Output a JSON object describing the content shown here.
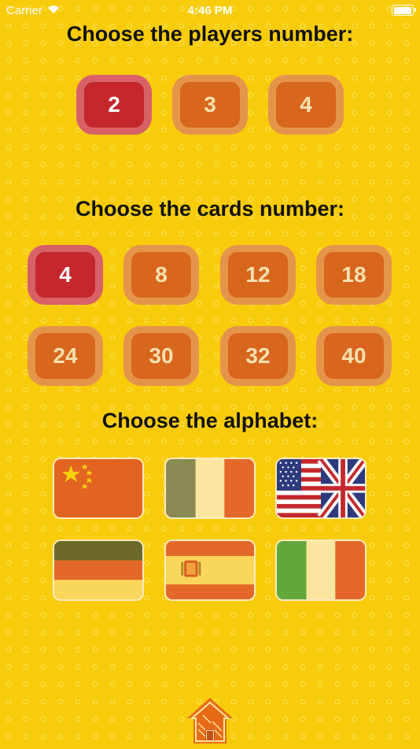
{
  "status": {
    "carrier": "Carrier",
    "time": "4:46 PM"
  },
  "players": {
    "heading": "Choose the players number:",
    "options": [
      "2",
      "3",
      "4"
    ],
    "selected": "2"
  },
  "cards": {
    "heading": "Choose the cards number:",
    "options": [
      "4",
      "8",
      "12",
      "18",
      "24",
      "30",
      "32",
      "40"
    ],
    "selected": "4"
  },
  "alphabet": {
    "heading": "Choose the alphabet:",
    "flags": [
      "china-flag",
      "ireland-flag",
      "usa-uk-flag",
      "germany-flag",
      "spain-flag",
      "italy-flag"
    ]
  },
  "colors": {
    "background": "#f8cc0b",
    "button_outer": "#e5954b",
    "button_inner": "#d8661d",
    "selected_outer": "#d86168",
    "selected_inner": "#c4282c"
  },
  "footer": {
    "icon": "home-icon"
  }
}
